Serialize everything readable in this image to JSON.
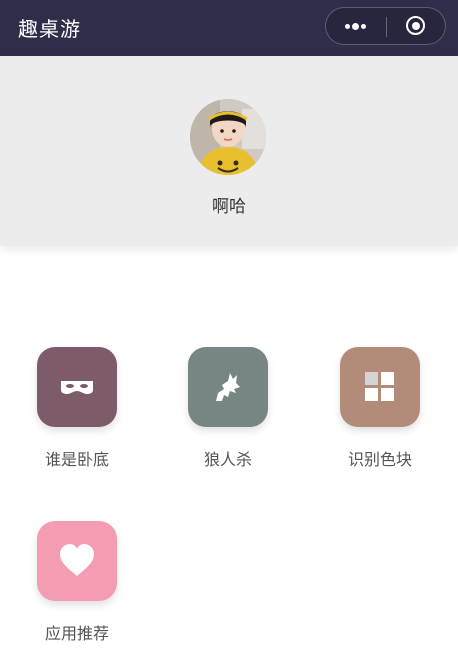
{
  "app": {
    "title": "趣桌游"
  },
  "capsule": {
    "more_icon": "more-dots-icon",
    "close_icon": "record-circle-icon"
  },
  "profile": {
    "username": "啊哈"
  },
  "games": [
    {
      "label": "谁是卧底",
      "icon": "mask-icon",
      "color": "#7d5b6b"
    },
    {
      "label": "狼人杀",
      "icon": "wolf-icon",
      "color": "#778584"
    },
    {
      "label": "识别色块",
      "icon": "color-blocks-icon",
      "color": "#b28b79"
    },
    {
      "label": "应用推荐",
      "icon": "heart-icon",
      "color": "#f49db2"
    }
  ]
}
